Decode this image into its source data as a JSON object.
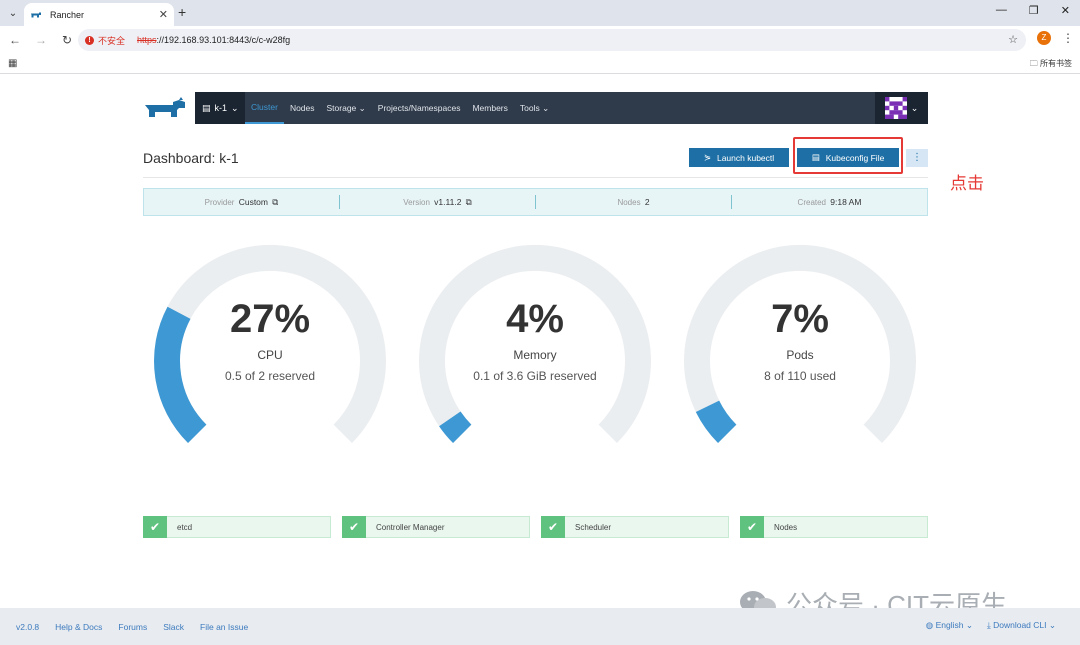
{
  "browser": {
    "tab_title": "Rancher",
    "tab_close": "✕",
    "new_tab": "+",
    "insecure_label": "不安全",
    "url_protocol": "https",
    "url_rest": "://192.168.93.101:8443/c/c-w28fg",
    "profile_initial": "Z",
    "bookmarks_label": "所有书签"
  },
  "header": {
    "cluster_name": "k-1",
    "nav": [
      "Cluster",
      "Nodes",
      "Storage",
      "Projects/Namespaces",
      "Members",
      "Tools"
    ],
    "active_nav": "Cluster"
  },
  "page": {
    "title": "Dashboard: k-1",
    "launch_kubectl": "Launch kubectl",
    "kubeconfig_file": "Kubeconfig File",
    "annotation": "点击"
  },
  "info": {
    "provider_label": "Provider",
    "provider_value": "Custom",
    "version_label": "Version",
    "version_value": "v1.11.2",
    "nodes_label": "Nodes",
    "nodes_value": "2",
    "created_label": "Created",
    "created_value": "9:18 AM"
  },
  "gauges": [
    {
      "percent": "27%",
      "label": "CPU",
      "sub": "0.5 of 2 reserved",
      "fraction": 0.27
    },
    {
      "percent": "4%",
      "label": "Memory",
      "sub": "0.1 of 3.6 GiB reserved",
      "fraction": 0.04
    },
    {
      "percent": "7%",
      "label": "Pods",
      "sub": "8 of 110 used",
      "fraction": 0.07
    }
  ],
  "status": [
    "etcd",
    "Controller Manager",
    "Scheduler",
    "Nodes"
  ],
  "footer": {
    "version": "v2.0.8",
    "help": "Help & Docs",
    "forums": "Forums",
    "slack": "Slack",
    "issue": "File an Issue",
    "language": "English",
    "download": "Download CLI"
  },
  "watermark": "公众号 · CIT云原生",
  "colors": {
    "header_bg": "#2f3a4a",
    "accent": "#1d6fa5",
    "gauge_fill": "#3d98d3",
    "gauge_track": "#ebeef0",
    "ok_green": "#5fc27f",
    "highlight_red": "#e53935"
  }
}
